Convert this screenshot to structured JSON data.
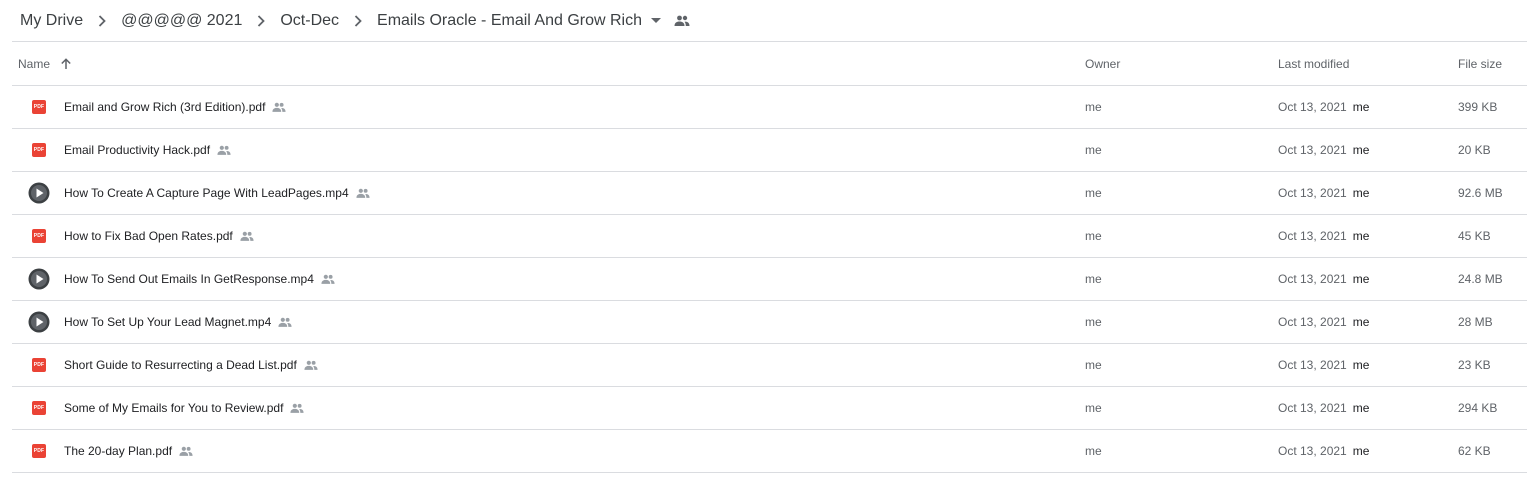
{
  "breadcrumb": {
    "items": [
      "My Drive",
      "@@@@@ 2021",
      "Oct-Dec"
    ],
    "current": "Emails Oracle - Email And Grow Rich",
    "current_caret_icon": "arrow-drop-down-icon",
    "shared_icon": "people-icon"
  },
  "table": {
    "headers": {
      "name": "Name",
      "owner": "Owner",
      "last_modified": "Last modified",
      "file_size": "File size"
    },
    "sort_icon": "arrow-up-icon",
    "rows": [
      {
        "type": "pdf",
        "name": "Email and Grow Rich (3rd Edition).pdf",
        "owner": "me",
        "modified": "Oct 13, 2021",
        "modified_by": "me",
        "size": "399 KB"
      },
      {
        "type": "pdf",
        "name": "Email Productivity Hack.pdf",
        "owner": "me",
        "modified": "Oct 13, 2021",
        "modified_by": "me",
        "size": "20 KB"
      },
      {
        "type": "video",
        "name": "How To Create A Capture Page With LeadPages.mp4",
        "owner": "me",
        "modified": "Oct 13, 2021",
        "modified_by": "me",
        "size": "92.6 MB"
      },
      {
        "type": "pdf",
        "name": "How to Fix Bad Open Rates.pdf",
        "owner": "me",
        "modified": "Oct 13, 2021",
        "modified_by": "me",
        "size": "45 KB"
      },
      {
        "type": "video",
        "name": "How To Send Out Emails In GetResponse.mp4",
        "owner": "me",
        "modified": "Oct 13, 2021",
        "modified_by": "me",
        "size": "24.8 MB"
      },
      {
        "type": "video",
        "name": "How To Set Up Your Lead Magnet.mp4",
        "owner": "me",
        "modified": "Oct 13, 2021",
        "modified_by": "me",
        "size": "28 MB"
      },
      {
        "type": "pdf",
        "name": "Short Guide to Resurrecting a Dead List.pdf",
        "owner": "me",
        "modified": "Oct 13, 2021",
        "modified_by": "me",
        "size": "23 KB"
      },
      {
        "type": "pdf",
        "name": "Some of My Emails for You to Review.pdf",
        "owner": "me",
        "modified": "Oct 13, 2021",
        "modified_by": "me",
        "size": "294 KB"
      },
      {
        "type": "pdf",
        "name": "The 20-day Plan.pdf",
        "owner": "me",
        "modified": "Oct 13, 2021",
        "modified_by": "me",
        "size": "62 KB"
      }
    ],
    "pdf_badge_text": "PDF"
  },
  "colors": {
    "pdf_red": "#ea4335",
    "divider": "#dadce0",
    "text_primary": "#202124",
    "text_secondary": "#5f6368"
  }
}
